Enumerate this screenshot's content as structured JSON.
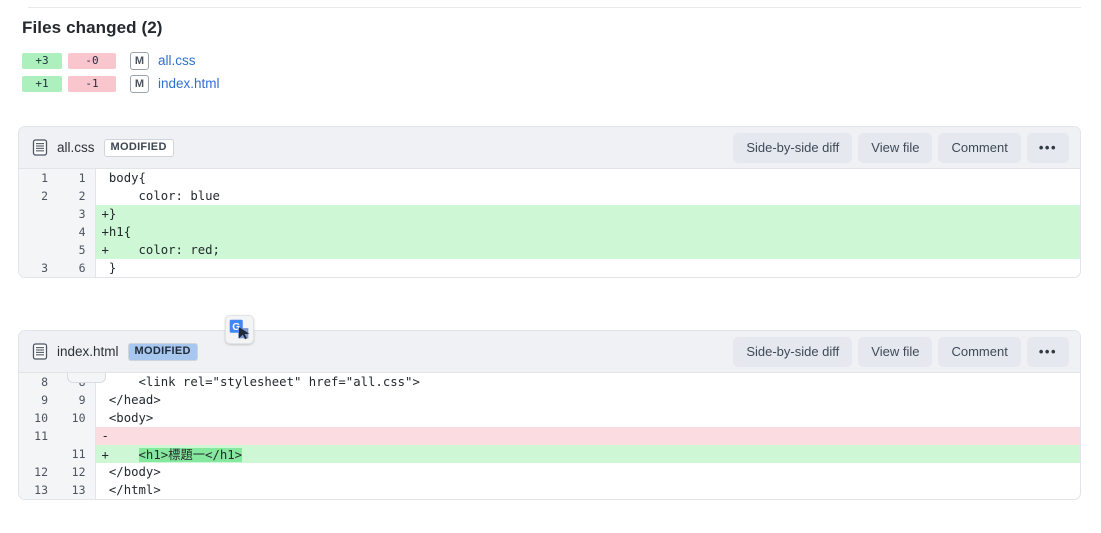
{
  "header": {
    "title": "Files changed (2)"
  },
  "summary": {
    "rows": [
      {
        "additions": "+3",
        "deletions": "-0",
        "status": "M",
        "filename": "all.css"
      },
      {
        "additions": "+1",
        "deletions": "-1",
        "status": "M",
        "filename": "index.html"
      }
    ]
  },
  "actions": {
    "side_by_side": "Side-by-side diff",
    "view_file": "View file",
    "comment": "Comment",
    "more": "•••",
    "expand": "•••"
  },
  "icons": {
    "file": "file-document-icon",
    "translate": "google-translate-icon"
  },
  "files": [
    {
      "name": "all.css",
      "badge": "MODIFIED",
      "badge_selected": false,
      "lines": [
        {
          "type": "ctx",
          "old": "1",
          "new": "1",
          "marker": " ",
          "code": "body{"
        },
        {
          "type": "ctx",
          "old": "2",
          "new": "2",
          "marker": " ",
          "code": "    color: blue"
        },
        {
          "type": "add",
          "old": "",
          "new": "3",
          "marker": "+",
          "code": "}"
        },
        {
          "type": "add",
          "old": "",
          "new": "4",
          "marker": "+",
          "code": "h1{"
        },
        {
          "type": "add",
          "old": "",
          "new": "5",
          "marker": "+",
          "code": "    color: red;"
        },
        {
          "type": "ctx",
          "old": "3",
          "new": "6",
          "marker": " ",
          "code": "}"
        }
      ]
    },
    {
      "name": "index.html",
      "badge": "MODIFIED",
      "badge_selected": true,
      "lines": [
        {
          "type": "ctx",
          "old": "8",
          "new": "8",
          "marker": " ",
          "code": "    <link rel=\"stylesheet\" href=\"all.css\">"
        },
        {
          "type": "ctx",
          "old": "9",
          "new": "9",
          "marker": " ",
          "code": "</head>"
        },
        {
          "type": "ctx",
          "old": "10",
          "new": "10",
          "marker": " ",
          "code": "<body>"
        },
        {
          "type": "del",
          "old": "11",
          "new": "",
          "marker": "-",
          "code": ""
        },
        {
          "type": "add",
          "old": "",
          "new": "11",
          "marker": "+",
          "code": "    <h1>標題一</h1>",
          "highlight": "<h1>標題一</h1>"
        },
        {
          "type": "ctx",
          "old": "12",
          "new": "12",
          "marker": " ",
          "code": "</body>"
        },
        {
          "type": "ctx",
          "old": "13",
          "new": "13",
          "marker": " ",
          "code": "</html>"
        }
      ]
    }
  ]
}
